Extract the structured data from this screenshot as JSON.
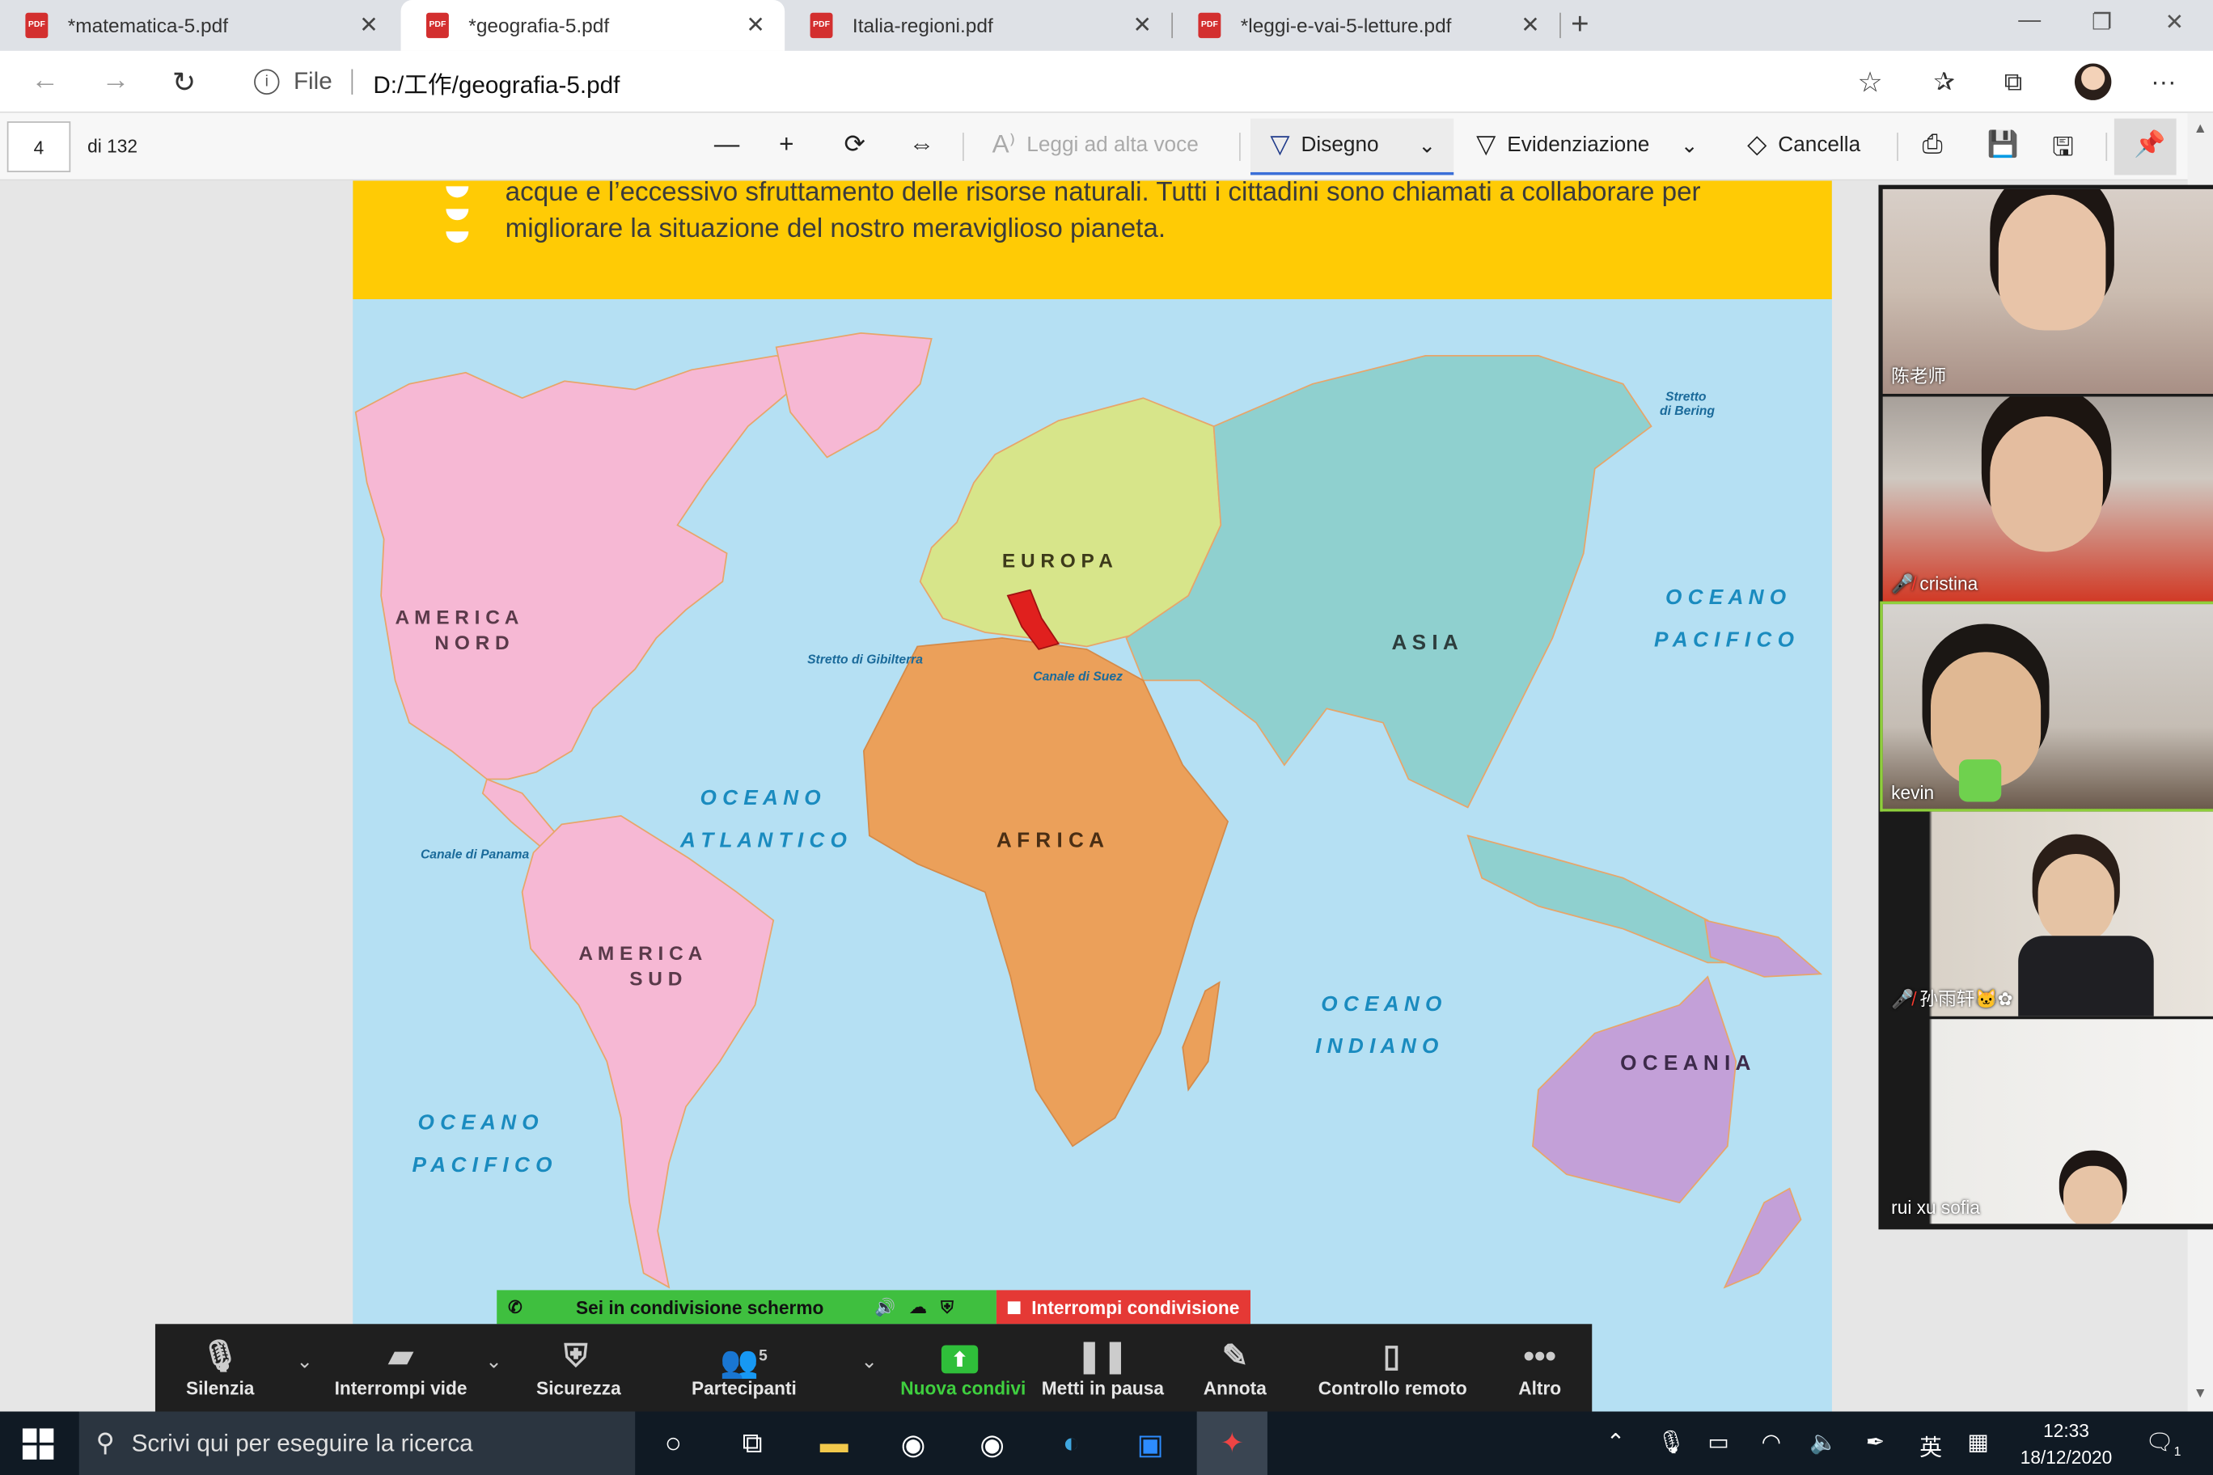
{
  "browser": {
    "tabs": [
      {
        "label": "*matematica-5.pdf"
      },
      {
        "label": "*geografia-5.pdf"
      },
      {
        "label": "Italia-regioni.pdf"
      },
      {
        "label": "*leggi-e-vai-5-letture.pdf"
      }
    ],
    "address": {
      "scheme": "File",
      "url": "D:/工作/geografia-5.pdf"
    }
  },
  "pdf_toolbar": {
    "page_current": "4",
    "page_total": "di 132",
    "read_aloud": "Leggi ad alta voce",
    "draw": "Disegno",
    "highlight": "Evidenziazione",
    "erase": "Cancella"
  },
  "document": {
    "line1": "acque e l’eccessivo sfruttamento delle risorse naturali. Tutti i cittadini sono chiamati a collaborare per",
    "line2": "migliorare la situazione del nostro meraviglioso pianeta.",
    "map_labels": {
      "america_nord_1": "A M E R I C A",
      "america_nord_2": "N O R D",
      "america_sud_1": "A M E R I C A",
      "america_sud_2": "S U D",
      "europa": "E U R O P A",
      "asia": "A S I A",
      "africa": "A F R I C A",
      "oceania": "O C E A N I A",
      "oceano_atlantico_1": "O C E A N O",
      "oceano_atlantico_2": "A T L A N T I C O",
      "oceano_pacifico_e_1": "O C E A N O",
      "oceano_pacifico_e_2": "P A C I F I C O",
      "oceano_pacifico_w_1": "O C E A N O",
      "oceano_pacifico_w_2": "P A C I F I C O",
      "oceano_indiano_1": "O C E A N O",
      "oceano_indiano_2": "I N D I A N O",
      "stretto_gibilterra": "Stretto di Gibilterra",
      "canale_suez": "Canale di Suez",
      "canale_panama": "Canale di Panama",
      "stretto_bering_1": "Stretto",
      "stretto_bering_2": "di Bering"
    },
    "continent_colors": {
      "north_america": "#f6b8d4",
      "south_america": "#f6b8d4",
      "europe": "#d7e58a",
      "asia": "#8fd0cf",
      "africa": "#eba05a",
      "oceania": "#c3a0d8",
      "italy": "#e0201e",
      "ocean": "#b5e0f3"
    }
  },
  "participants": [
    {
      "name": "陈老师",
      "muted": false
    },
    {
      "name": "cristina",
      "muted": true
    },
    {
      "name": "kevin",
      "muted": false
    },
    {
      "name": "孙雨轩🐱✿",
      "muted": true
    },
    {
      "name": "rui xu sofia",
      "muted": false
    }
  ],
  "zoom": {
    "sharing_status": "Sei in condivisione schermo",
    "stop_share": "Interrompi condivisione",
    "buttons": {
      "mute": "Silenzia",
      "video": "Interrompi vide",
      "security": "Sicurezza",
      "participants": "Partecipanti",
      "participants_count": "5",
      "new_share": "Nuova condivi",
      "pause": "Metti in pausa",
      "annotate": "Annota",
      "remote": "Controllo remoto",
      "more": "Altro"
    }
  },
  "taskbar": {
    "search_placeholder": "Scrivi qui per eseguire la ricerca",
    "ime": "英",
    "time": "12:33",
    "date": "18/12/2020",
    "notification_count": "1"
  }
}
